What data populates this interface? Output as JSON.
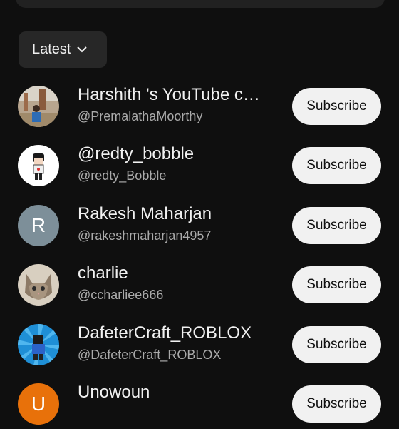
{
  "sort": {
    "label": "Latest",
    "icon": "chevron-down-icon"
  },
  "channels": [
    {
      "name": " Harshith 's YouTube c…",
      "handle": "@PremalathaMoorthy",
      "button": "Subscribe"
    },
    {
      "name": "@redty_bobble",
      "handle": "@redty_Bobble",
      "button": "Subscribe"
    },
    {
      "name": "Rakesh Maharjan",
      "handle": "@rakeshmaharjan4957",
      "button": "Subscribe",
      "avatar_letter": "R",
      "avatar_color": "#7d8f99"
    },
    {
      "name": "charlie",
      "handle": "@ccharliee666",
      "button": "Subscribe"
    },
    {
      "name": "DafeterCraft_ROBLOX",
      "handle": "@DafeterCraft_ROBLOX",
      "button": "Subscribe"
    },
    {
      "name": "Unowoun",
      "handle": "",
      "button": "Subscribe",
      "avatar_letter": "U",
      "avatar_color": "#e8710a"
    }
  ],
  "colors": {
    "background": "#0f0f0f",
    "chip": "#272727",
    "button": "#f1f1f1",
    "secondary_text": "#aaaaaa"
  }
}
